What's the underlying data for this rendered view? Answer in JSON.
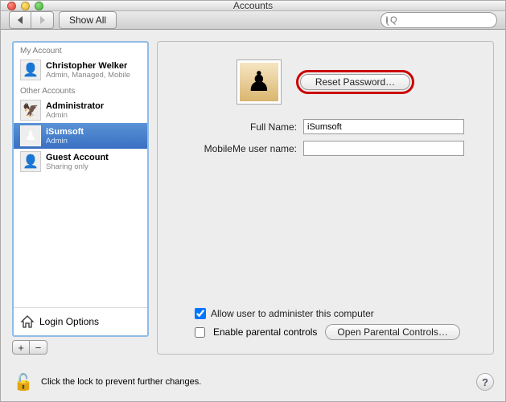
{
  "window": {
    "title": "Accounts"
  },
  "toolbar": {
    "show_all": "Show All",
    "search_placeholder": "Q"
  },
  "sidebar": {
    "my_account_header": "My Account",
    "other_accounts_header": "Other Accounts",
    "accounts": [
      {
        "name": "Christopher Welker",
        "sub": "Admin, Managed, Mobile",
        "icon": "👤",
        "selected": false
      },
      {
        "name": "Administrator",
        "sub": "Admin",
        "icon": "🦅",
        "selected": false
      },
      {
        "name": "iSumsoft",
        "sub": "Admin",
        "icon": "♟",
        "selected": true
      },
      {
        "name": "Guest Account",
        "sub": "Sharing only",
        "icon": "👤",
        "selected": false
      }
    ],
    "login_options": "Login Options",
    "add": "+",
    "remove": "−"
  },
  "main": {
    "reset_password": "Reset Password…",
    "full_name_label": "Full Name:",
    "full_name_value": "iSumsoft",
    "mobileme_label": "MobileMe user name:",
    "mobileme_value": "",
    "allow_admin_label": "Allow user to administer this computer",
    "allow_admin_checked": true,
    "parental_label": "Enable parental controls",
    "parental_checked": false,
    "open_parental": "Open Parental Controls…"
  },
  "footer": {
    "lock_text": "Click the lock to prevent further changes.",
    "help": "?"
  }
}
